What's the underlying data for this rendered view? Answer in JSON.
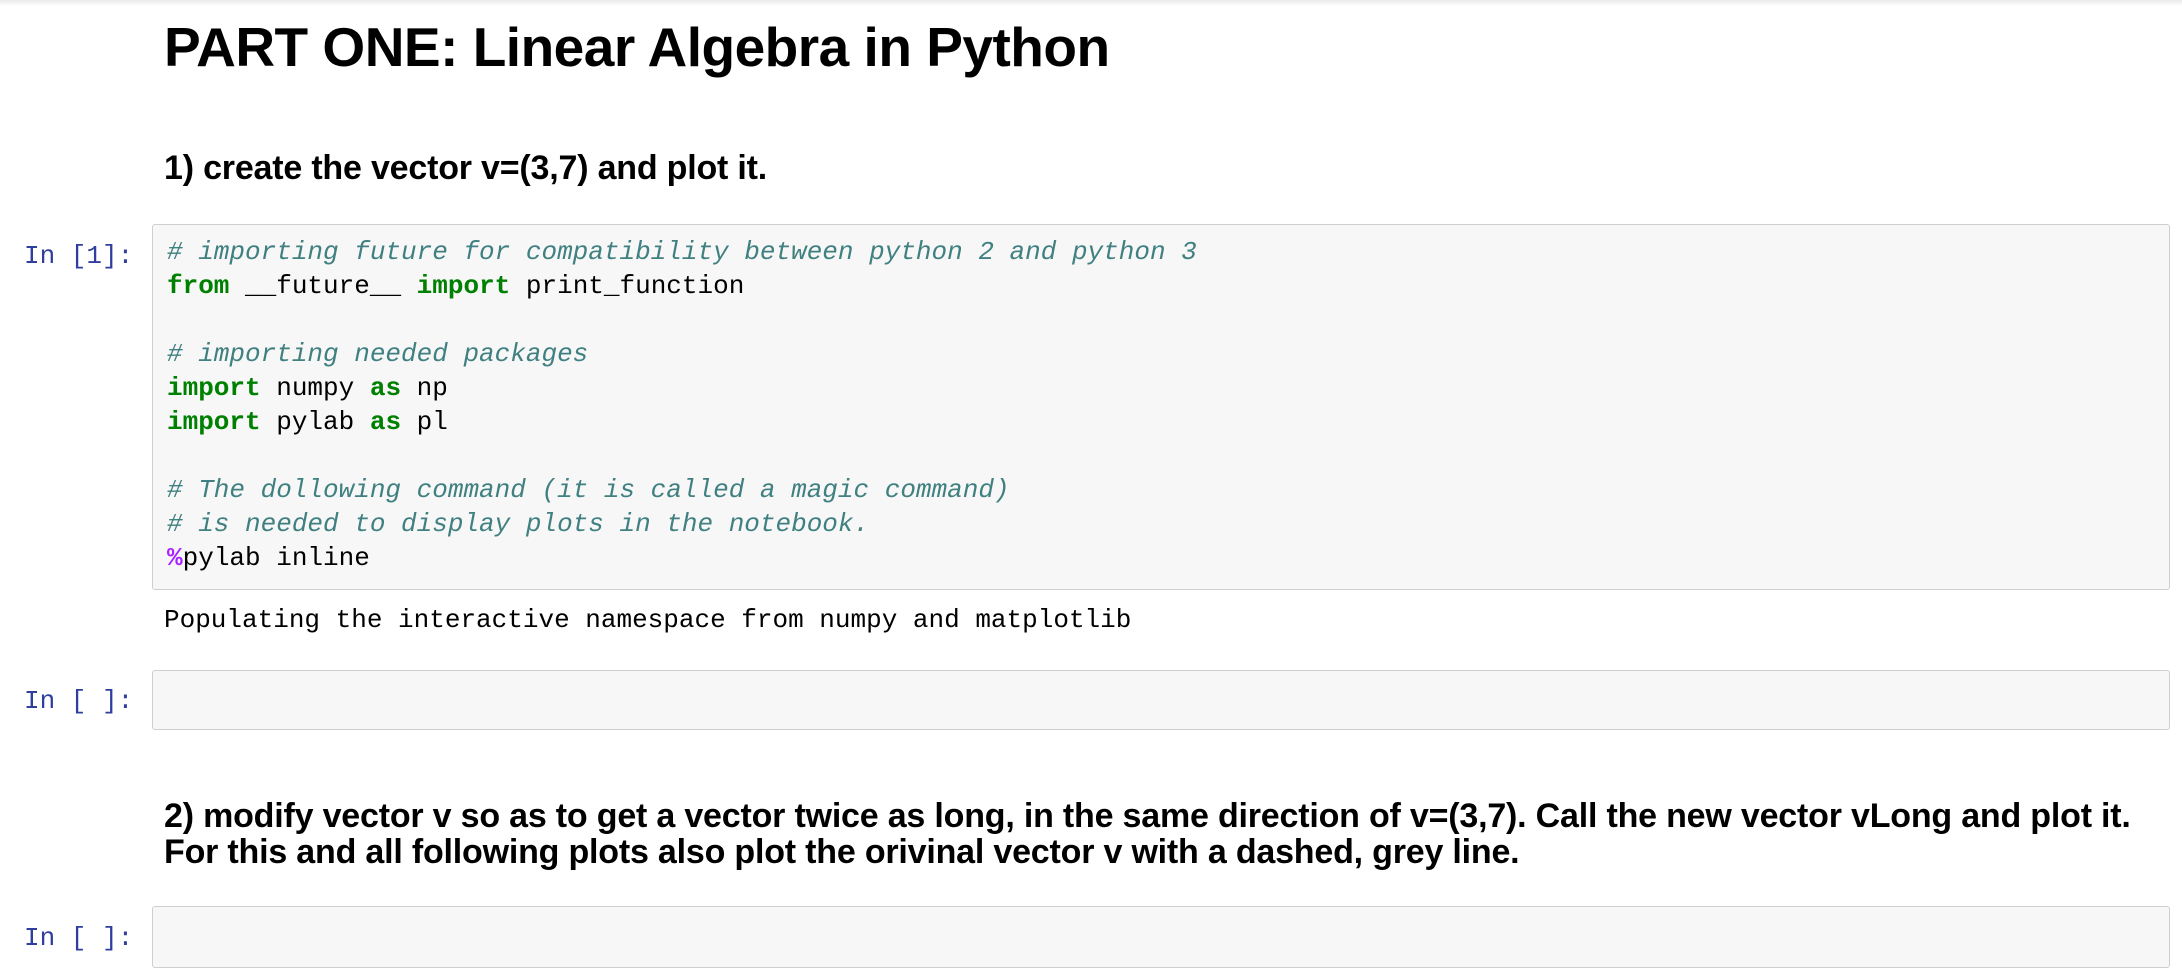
{
  "heading": "PART ONE: Linear Algebra in Python",
  "question_1": "1) create the vector v=(3,7) and plot it.",
  "cell_1": {
    "prompt": "In [1]:",
    "lines": {
      "l1": "# importing future for compatibility between python 2 and python 3",
      "l2_kw1": "from",
      "l2_mid": " __future__ ",
      "l2_kw2": "import",
      "l2_rest": " print_function",
      "l3": "# importing needed packages",
      "l4_kw1": "import",
      "l4_mid": " numpy ",
      "l4_kw2": "as",
      "l4_rest": " np",
      "l5_kw1": "import",
      "l5_mid": " pylab ",
      "l5_kw2": "as",
      "l5_rest": " pl",
      "l6": "# The dollowing command (it is called a magic command)",
      "l7": "# is needed to display plots in the notebook.",
      "l8_magic": "%",
      "l8_rest": "pylab inline"
    },
    "output": "Populating the interactive namespace from numpy and matplotlib"
  },
  "cell_2": {
    "prompt": "In [ ]:",
    "code": ""
  },
  "question_2": "2) modify vector v so as to get a vector twice as long, in the same direction of v=(3,7). Call the new vector vLong and plot it. For this and all following plots also plot the orivinal vector v with a dashed, grey line.",
  "cell_3": {
    "prompt": "In [ ]:",
    "code": ""
  }
}
